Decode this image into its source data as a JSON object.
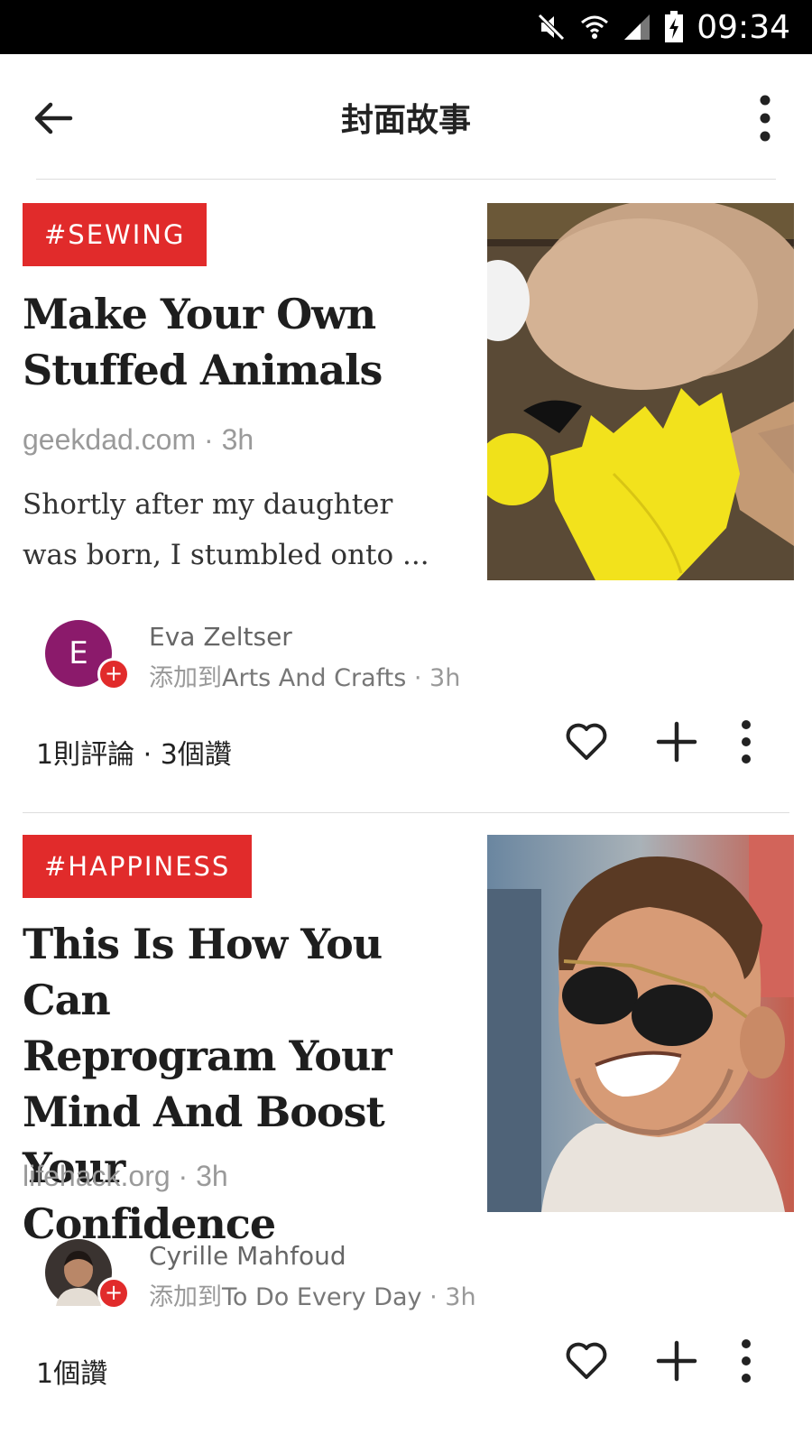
{
  "status_bar": {
    "time": "09:34",
    "icons": [
      "mute-icon",
      "wifi-icon",
      "signal-icon",
      "battery-charging-icon"
    ]
  },
  "app_bar": {
    "title": "封面故事",
    "back_icon": "arrow-left-icon",
    "menu_icon": "more-vertical-icon"
  },
  "colors": {
    "accent": "#e12b2b",
    "avatar_eva": "#8b1a6b"
  },
  "articles": [
    {
      "tag": "#SEWING",
      "title_lines": [
        "Make Your Own",
        "Stuffed Animals"
      ],
      "source": "geekdad.com · 3h",
      "excerpt_lines": [
        "Shortly after my daughter",
        "was born, I stumbled onto ..."
      ],
      "curator": {
        "initial": "E",
        "name": "Eva Zeltser",
        "added_prefix": "添加到",
        "magazine": "Arts And Crafts",
        "time": " · 3h"
      },
      "social": "1則評論 · 3個讚"
    },
    {
      "tag": "#HAPPINESS",
      "title_lines": [
        "This Is How You Can",
        "Reprogram Your",
        "Mind And Boost Your",
        "Confidence"
      ],
      "source": "lifehack.org · 3h",
      "curator": {
        "name": "Cyrille Mahfoud",
        "added_prefix": "添加到",
        "magazine": "To Do Every Day",
        "time": " · 3h"
      },
      "social": "1個讚"
    }
  ]
}
